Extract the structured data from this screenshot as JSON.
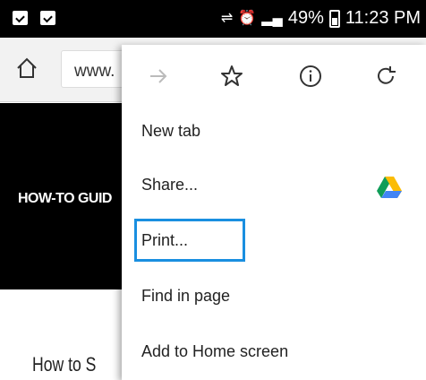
{
  "status_bar": {
    "battery_percent": "49%",
    "time": "11:23 PM"
  },
  "toolbar": {
    "url_text": "www."
  },
  "page": {
    "hero_text": "HOW-TO GUID",
    "article_heading": "How to S"
  },
  "menu": {
    "icons": [
      "forward-arrow-icon",
      "star-icon",
      "info-icon",
      "refresh-icon"
    ],
    "items": [
      {
        "label": "New tab"
      },
      {
        "label": "Share..."
      },
      {
        "label": "Print..."
      },
      {
        "label": "Find in page"
      },
      {
        "label": "Add to Home screen"
      }
    ],
    "highlight_color": "#1a8fe0"
  }
}
